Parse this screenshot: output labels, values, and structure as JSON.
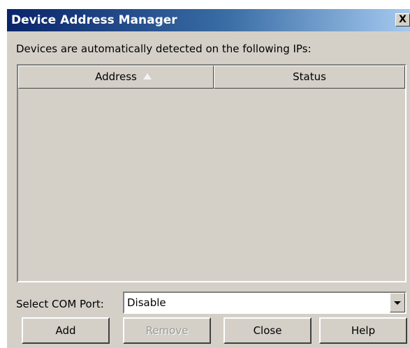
{
  "window": {
    "title": "Device Address Manager",
    "close_glyph": "X"
  },
  "intro_text": "Devices are automatically detected on the following IPs:",
  "device_list": {
    "columns": [
      {
        "label": "Address",
        "sorted": "ascending"
      },
      {
        "label": "Status"
      }
    ],
    "rows": []
  },
  "com_port": {
    "label": "Select COM Port:",
    "selected": "Disable"
  },
  "buttons": {
    "add": "Add",
    "remove": "Remove",
    "close": "Close",
    "help": "Help"
  }
}
